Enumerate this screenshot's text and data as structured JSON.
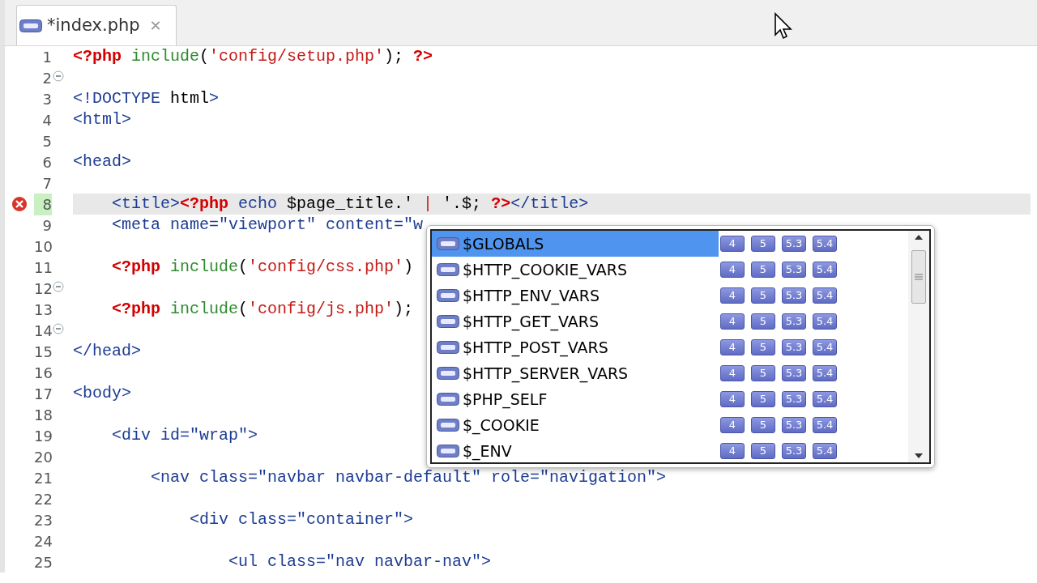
{
  "tab": {
    "title": "*index.php",
    "close": "✕"
  },
  "lines": [
    {
      "number": "1",
      "fold": false,
      "current": false,
      "error": false,
      "tokens": [
        {
          "kind": "php",
          "text": "<?php "
        },
        {
          "kind": "func",
          "text": "include"
        },
        {
          "kind": "plain",
          "text": "("
        },
        {
          "kind": "str",
          "text": "'config/setup.php'"
        },
        {
          "kind": "plain",
          "text": "); "
        },
        {
          "kind": "php",
          "text": "?>"
        }
      ]
    },
    {
      "number": "2",
      "fold": true,
      "current": false,
      "error": false
    },
    {
      "number": "3",
      "fold": false,
      "current": false,
      "error": false,
      "tokens": [
        {
          "kind": "tag",
          "text": "<!DOCTYPE"
        },
        {
          "kind": "plain",
          "text": " html"
        },
        {
          "kind": "tag",
          "text": ">"
        }
      ]
    },
    {
      "number": "4",
      "fold": false,
      "current": false,
      "error": false,
      "tokens": [
        {
          "kind": "tag",
          "text": "<html>"
        }
      ]
    },
    {
      "number": "5",
      "fold": false,
      "current": false,
      "error": false
    },
    {
      "number": "6",
      "fold": false,
      "current": false,
      "error": false,
      "tokens": [
        {
          "kind": "tag",
          "text": "<head>"
        }
      ]
    },
    {
      "number": "7",
      "fold": false,
      "current": false,
      "error": false
    },
    {
      "number": "8",
      "fold": false,
      "current": true,
      "error": true,
      "tokens": [
        {
          "kind": "tag",
          "text": "    <title>"
        },
        {
          "kind": "php",
          "text": "<?php"
        },
        {
          "kind": "tag",
          "text": " echo "
        },
        {
          "kind": "plain",
          "text": "$page_title.'"
        },
        {
          "kind": "str",
          "text": " | "
        },
        {
          "kind": "plain",
          "text": "'.$; "
        },
        {
          "kind": "php",
          "text": "?>"
        },
        {
          "kind": "tag",
          "text": "</title>"
        }
      ]
    },
    {
      "number": "9",
      "fold": false,
      "current": false,
      "error": false,
      "tokens": [
        {
          "kind": "tag",
          "text": "    <meta name=\"viewport\" content=\"w"
        }
      ]
    },
    {
      "number": "10",
      "fold": false,
      "current": false,
      "error": false
    },
    {
      "number": "11",
      "fold": false,
      "current": false,
      "error": false,
      "tokens": [
        {
          "kind": "php",
          "text": "    <?php "
        },
        {
          "kind": "func",
          "text": "include"
        },
        {
          "kind": "plain",
          "text": "("
        },
        {
          "kind": "str",
          "text": "'config/css.php'"
        },
        {
          "kind": "plain",
          "text": ")"
        }
      ]
    },
    {
      "number": "12",
      "fold": true,
      "current": false,
      "error": false
    },
    {
      "number": "13",
      "fold": false,
      "current": false,
      "error": false,
      "tokens": [
        {
          "kind": "php",
          "text": "    <?php "
        },
        {
          "kind": "func",
          "text": "include"
        },
        {
          "kind": "plain",
          "text": "("
        },
        {
          "kind": "str",
          "text": "'config/js.php'"
        },
        {
          "kind": "plain",
          "text": ");"
        }
      ]
    },
    {
      "number": "14",
      "fold": true,
      "current": false,
      "error": false
    },
    {
      "number": "15",
      "fold": false,
      "current": false,
      "error": false,
      "tokens": [
        {
          "kind": "tag",
          "text": "</head>"
        }
      ]
    },
    {
      "number": "16",
      "fold": false,
      "current": false,
      "error": false
    },
    {
      "number": "17",
      "fold": false,
      "current": false,
      "error": false,
      "tokens": [
        {
          "kind": "tag",
          "text": "<body>"
        }
      ]
    },
    {
      "number": "18",
      "fold": false,
      "current": false,
      "error": false
    },
    {
      "number": "19",
      "fold": false,
      "current": false,
      "error": false,
      "tokens": [
        {
          "kind": "tag",
          "text": "    <div id=\"wrap\">"
        }
      ]
    },
    {
      "number": "20",
      "fold": false,
      "current": false,
      "error": false
    },
    {
      "number": "21",
      "fold": false,
      "current": false,
      "error": false,
      "tokens": [
        {
          "kind": "tag",
          "text": "        <nav class=\"navbar navbar-default\" role=\"navigation\">"
        }
      ]
    },
    {
      "number": "22",
      "fold": false,
      "current": false,
      "error": false
    },
    {
      "number": "23",
      "fold": false,
      "current": false,
      "error": false,
      "tokens": [
        {
          "kind": "tag",
          "text": "            <div class=\"container\">"
        }
      ]
    },
    {
      "number": "24",
      "fold": false,
      "current": false,
      "error": false
    },
    {
      "number": "25",
      "fold": false,
      "current": false,
      "error": false,
      "tokens": [
        {
          "kind": "tag",
          "text": "                <ul class=\"nav navbar-nav\">"
        }
      ]
    }
  ],
  "completion": {
    "items": [
      {
        "name": "$GLOBALS",
        "selected": true,
        "versions": [
          "4",
          "5",
          "5.3",
          "5.4"
        ]
      },
      {
        "name": "$HTTP_COOKIE_VARS",
        "selected": false,
        "versions": [
          "4",
          "5",
          "5.3",
          "5.4"
        ]
      },
      {
        "name": "$HTTP_ENV_VARS",
        "selected": false,
        "versions": [
          "4",
          "5",
          "5.3",
          "5.4"
        ]
      },
      {
        "name": "$HTTP_GET_VARS",
        "selected": false,
        "versions": [
          "4",
          "5",
          "5.3",
          "5.4"
        ]
      },
      {
        "name": "$HTTP_POST_VARS",
        "selected": false,
        "versions": [
          "4",
          "5",
          "5.3",
          "5.4"
        ]
      },
      {
        "name": "$HTTP_SERVER_VARS",
        "selected": false,
        "versions": [
          "4",
          "5",
          "5.3",
          "5.4"
        ]
      },
      {
        "name": "$PHP_SELF",
        "selected": false,
        "versions": [
          "4",
          "5",
          "5.3",
          "5.4"
        ]
      },
      {
        "name": "$_COOKIE",
        "selected": false,
        "versions": [
          "4",
          "5",
          "5.3",
          "5.4"
        ]
      },
      {
        "name": "$_ENV",
        "selected": false,
        "versions": [
          "4",
          "5",
          "5.3",
          "5.4"
        ]
      }
    ]
  }
}
